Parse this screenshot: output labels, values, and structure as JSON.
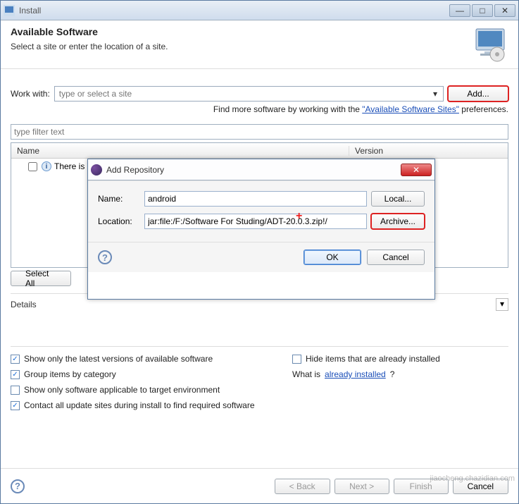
{
  "window": {
    "title": "Install"
  },
  "header": {
    "title": "Available Software",
    "subtitle": "Select a site or enter the location of a site."
  },
  "workwith": {
    "label": "Work with:",
    "placeholder": "type or select a site",
    "add_button": "Add..."
  },
  "findmore": {
    "prefix": "Find more software by working with the ",
    "link": "\"Available Software Sites\"",
    "suffix": " preferences."
  },
  "filter_placeholder": "type filter text",
  "columns": {
    "name": "Name",
    "version": "Version"
  },
  "row_text": "There is",
  "buttons": {
    "select_all": "Select All",
    "ok": "OK",
    "cancel": "Cancel",
    "back": "< Back",
    "next": "Next >",
    "finish": "Finish",
    "cancel_wiz": "Cancel"
  },
  "details_label": "Details",
  "options": {
    "show_latest": "Show only the latest versions of available software",
    "hide_installed": "Hide items that are already installed",
    "group_by_category": "Group items by category",
    "what_is_prefix": "What is ",
    "what_is_link": "already installed",
    "what_is_suffix": "?",
    "show_applicable": "Show only software applicable to target environment",
    "contact_all": "Contact all update sites during install to find required software"
  },
  "checks": {
    "show_latest": true,
    "hide_installed": false,
    "group_by_category": true,
    "show_applicable": false,
    "contact_all": true
  },
  "dialog": {
    "title": "Add Repository",
    "name_label": "Name:",
    "name_value": "android",
    "loc_label": "Location:",
    "loc_value": "jar:file:/F:/Software For Studing/ADT-20.0.3.zip!/",
    "local_btn": "Local...",
    "archive_btn": "Archive..."
  },
  "watermark": "jiaocheng.chazidian.com"
}
